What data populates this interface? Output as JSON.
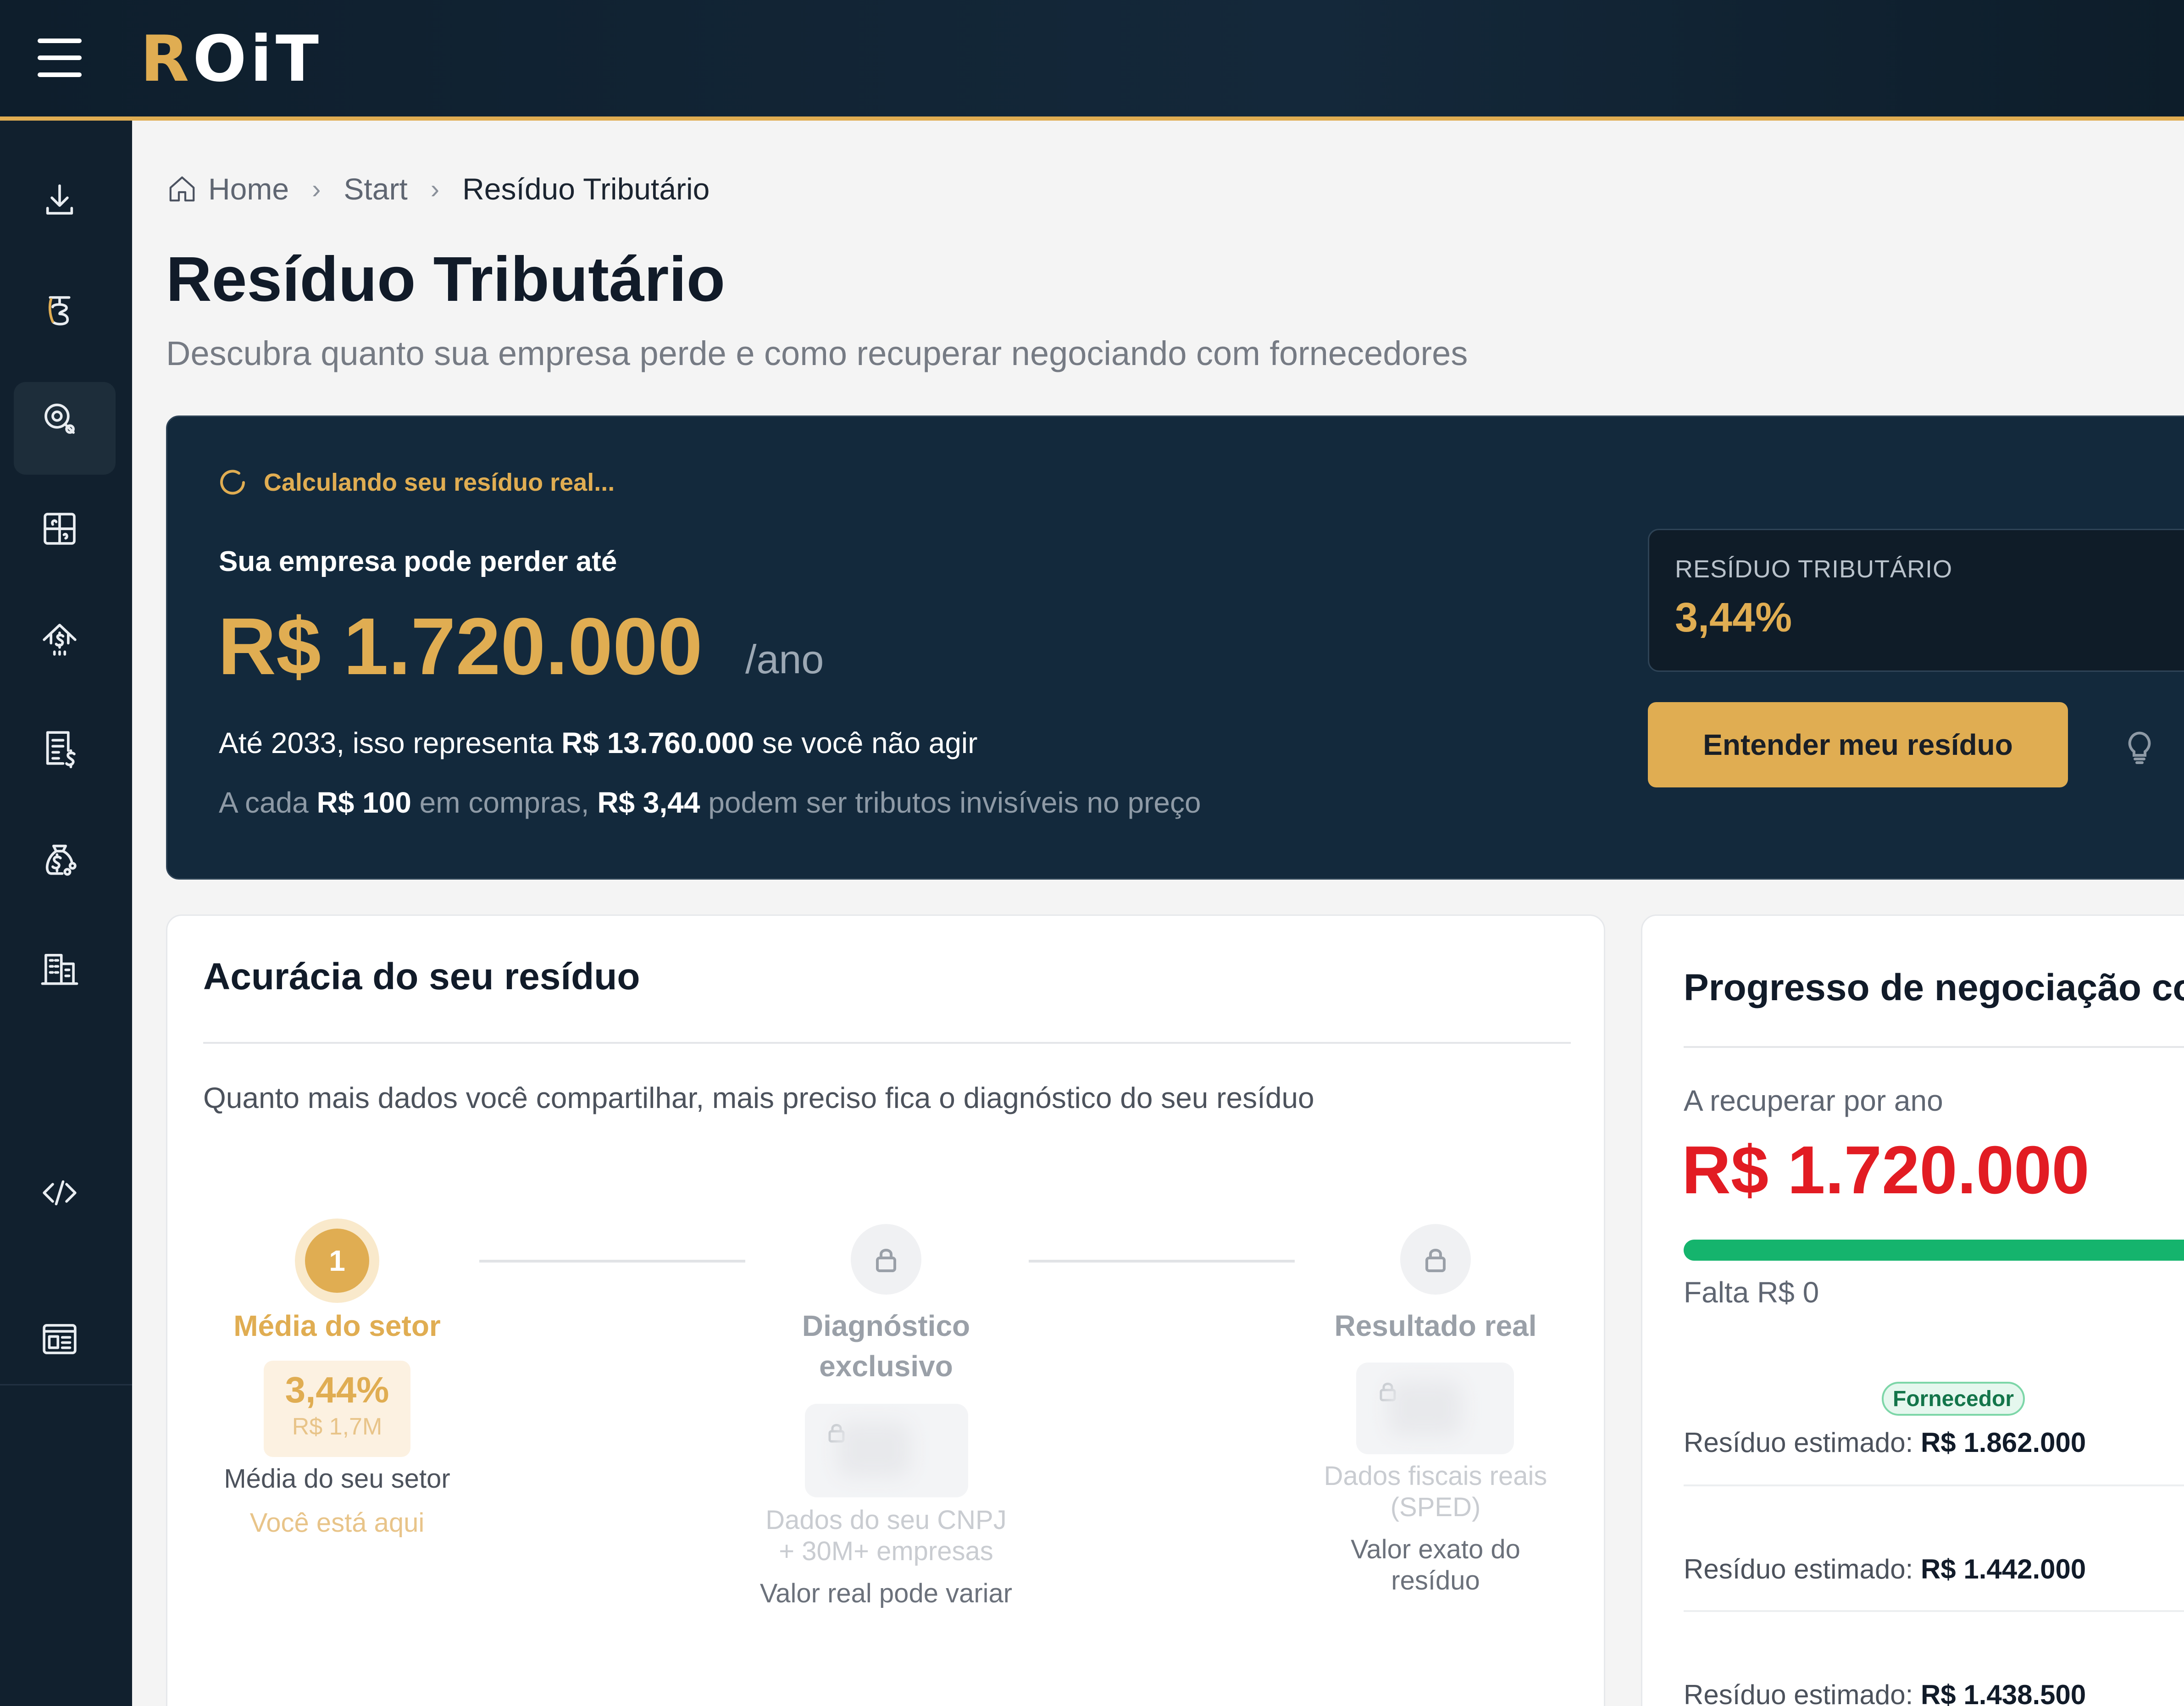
{
  "header": {
    "logo_text": "ROIT",
    "logo_initial": "R",
    "logo_rest": "OiT"
  },
  "sidebar": {
    "items": [
      {
        "icon": "download-icon"
      },
      {
        "icon": "residuo-icon",
        "active": true
      },
      {
        "icon": "search-gear-icon"
      },
      {
        "icon": "puzzle-money-icon"
      },
      {
        "icon": "upload-money-icon"
      },
      {
        "icon": "invoice-icon"
      },
      {
        "icon": "money-bag-icon"
      },
      {
        "icon": "buildings-icon"
      },
      {
        "icon": "code-icon"
      },
      {
        "icon": "dashboard-icon"
      }
    ]
  },
  "breadcrumb": {
    "home": "Home",
    "start": "Start",
    "current": "Resíduo Tributário"
  },
  "page": {
    "title": "Resíduo Tributário",
    "subtitle": "Descubra quanto sua empresa perde e como recuperar negociando com fornecedores"
  },
  "hero": {
    "calculating": "Calculando seu resíduo real...",
    "label": "Sua empresa pode perder até",
    "amount": "R$ 1.720.000",
    "unit": "/ano",
    "line1_pre": "Até 2033, isso representa ",
    "line1_value": "R$ 13.760.000",
    "line1_post": " se você não agir",
    "line2_a": "A cada ",
    "line2_b": "R$ 100",
    "line2_c": " em compras, ",
    "line2_d": "R$ 3,44",
    "line2_e": " podem ser tributos invisíveis no preço",
    "residuo_label": "RESÍDUO TRIBUTÁRIO",
    "residuo_value": "3,44%",
    "cta": "Entender meu resíduo"
  },
  "accuracy": {
    "title": "Acurácia do seu resíduo",
    "description": "Quanto mais dados você compartilhar, mais preciso fica o diagnóstico do seu resíduo",
    "steps": [
      {
        "number": "1",
        "title": "Média do setor",
        "stat_main": "3,44%",
        "stat_sub": "R$ 1,7M",
        "caption": "Média do seu setor",
        "note": "Você está aqui"
      },
      {
        "title_l1": "Diagnóstico",
        "title_l2": "exclusivo",
        "source_l1": "Dados do seu CNPJ",
        "source_l2": "+ 30M+ empresas",
        "caption": "Valor real pode variar"
      },
      {
        "title": "Resultado real",
        "source_l1": "Dados fiscais reais",
        "source_l2": "(SPED)",
        "caption_l1": "Valor exato do",
        "caption_l2": "resíduo"
      }
    ]
  },
  "progress": {
    "title": "Progresso de negociação co",
    "recover_label": "A recuperar por ano",
    "recover_amount": "R$ 1.720.000",
    "bar_fill": 1.0,
    "remaining": "Falta R$ 0",
    "badge": "Fornecedor",
    "rows": [
      {
        "label": "Resíduo estimado: ",
        "value": "R$ 1.862.000"
      },
      {
        "label": "Resíduo estimado: ",
        "value": "R$ 1.442.000"
      },
      {
        "label": "Resíduo estimado: ",
        "value": "R$ 1.438.500"
      }
    ]
  },
  "colors": {
    "accent": "#e0ad52",
    "navy": "#13293c",
    "red": "#e21c23",
    "green": "#15b46d"
  }
}
